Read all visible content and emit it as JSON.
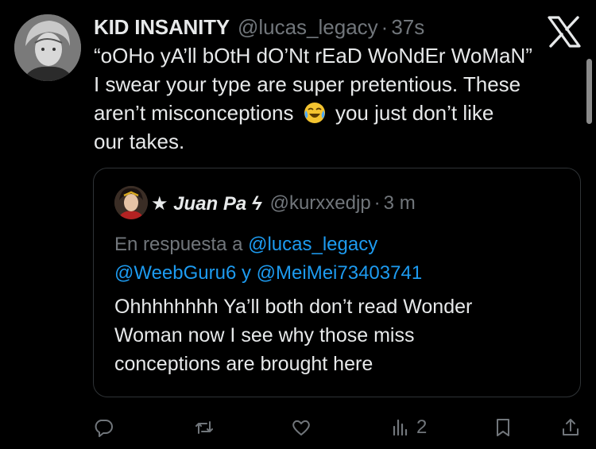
{
  "author": {
    "name": "KID INSANITY",
    "handle": "@lucas_legacy",
    "separator": "·",
    "time": "37s"
  },
  "tweet": {
    "line1": "“oOHo yA’ll bOtH dO’Nt rEaD WoNdEr WoMaN”",
    "line2": "I swear your type are super pretentious. These",
    "line3a": "aren’t misconceptions",
    "emoji": "face-with-tears-of-joy",
    "line3b": "you just don’t like",
    "line4": "our takes."
  },
  "quote": {
    "name": "★ Juan Pa ϟ",
    "handle": "@kurxxedjp",
    "separator": "·",
    "time": "3 m",
    "reply_prefix": "En respuesta a",
    "mention1": "@lucas_legacy",
    "mention2": "@WeebGuru6",
    "joiner": "y",
    "mention3": "@MeiMei73403741",
    "text_line1": "Ohhhhhhhh Ya’ll both don’t read Wonder",
    "text_line2": "Woman now I see why those miss",
    "text_line3": "conceptions are brought here"
  },
  "actions": {
    "views_count": "2"
  },
  "icons": [
    "x-logo-icon",
    "reply-icon",
    "retweet-icon",
    "like-icon",
    "views-icon",
    "bookmark-icon",
    "share-icon"
  ],
  "colors": {
    "background": "#000000",
    "text": "#e7e9ea",
    "secondary": "#71767b",
    "link": "#1d9bf0",
    "border": "#2f3336"
  }
}
